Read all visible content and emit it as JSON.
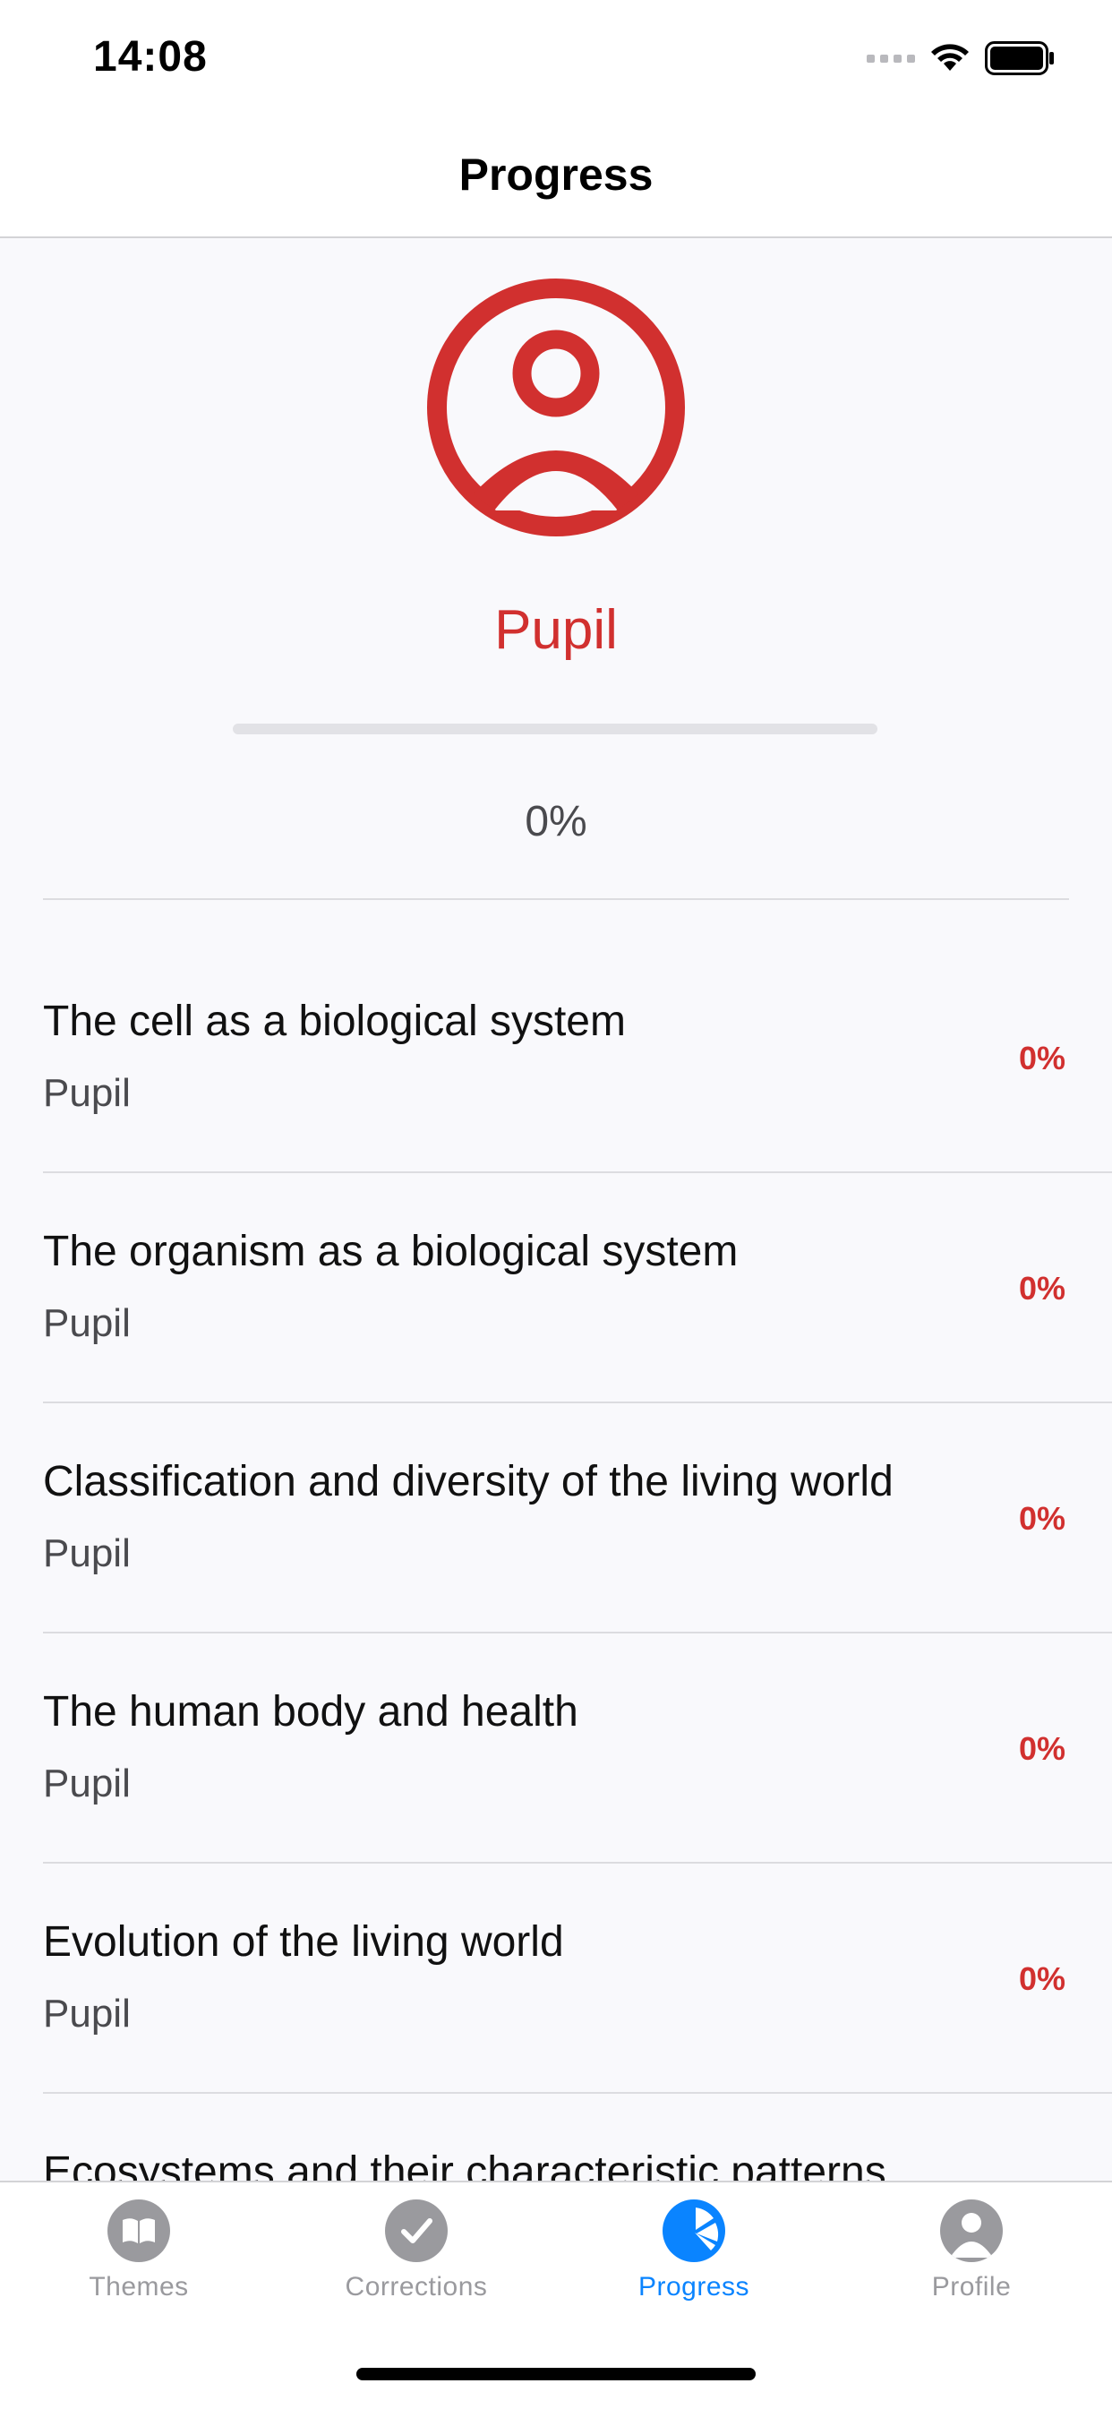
{
  "status_bar": {
    "time": "14:08"
  },
  "nav": {
    "title": "Progress"
  },
  "header": {
    "level": "Pupil",
    "progress_percent": 0,
    "percent_label": "0%"
  },
  "themes": [
    {
      "title": "The cell as a biological system",
      "level": "Pupil",
      "percent": "0%"
    },
    {
      "title": "The organism as a biological system",
      "level": "Pupil",
      "percent": "0%"
    },
    {
      "title": "Classification and diversity of the living world",
      "level": "Pupil",
      "percent": "0%"
    },
    {
      "title": "The human body and health",
      "level": "Pupil",
      "percent": "0%"
    },
    {
      "title": "Evolution of the living world",
      "level": "Pupil",
      "percent": "0%"
    },
    {
      "title": "Ecosystems and their characteristic patterns",
      "level": "",
      "percent": ""
    }
  ],
  "tabs": [
    {
      "label": "Themes",
      "icon": "book-icon",
      "active": false
    },
    {
      "label": "Corrections",
      "icon": "checkmark-icon",
      "active": false
    },
    {
      "label": "Progress",
      "icon": "pie-chart-icon",
      "active": true
    },
    {
      "label": "Profile",
      "icon": "person-icon",
      "active": false
    }
  ],
  "colors": {
    "accent": "#d1302f",
    "tab_active": "#0a84ff",
    "tab_inactive": "#9a9a9e"
  }
}
